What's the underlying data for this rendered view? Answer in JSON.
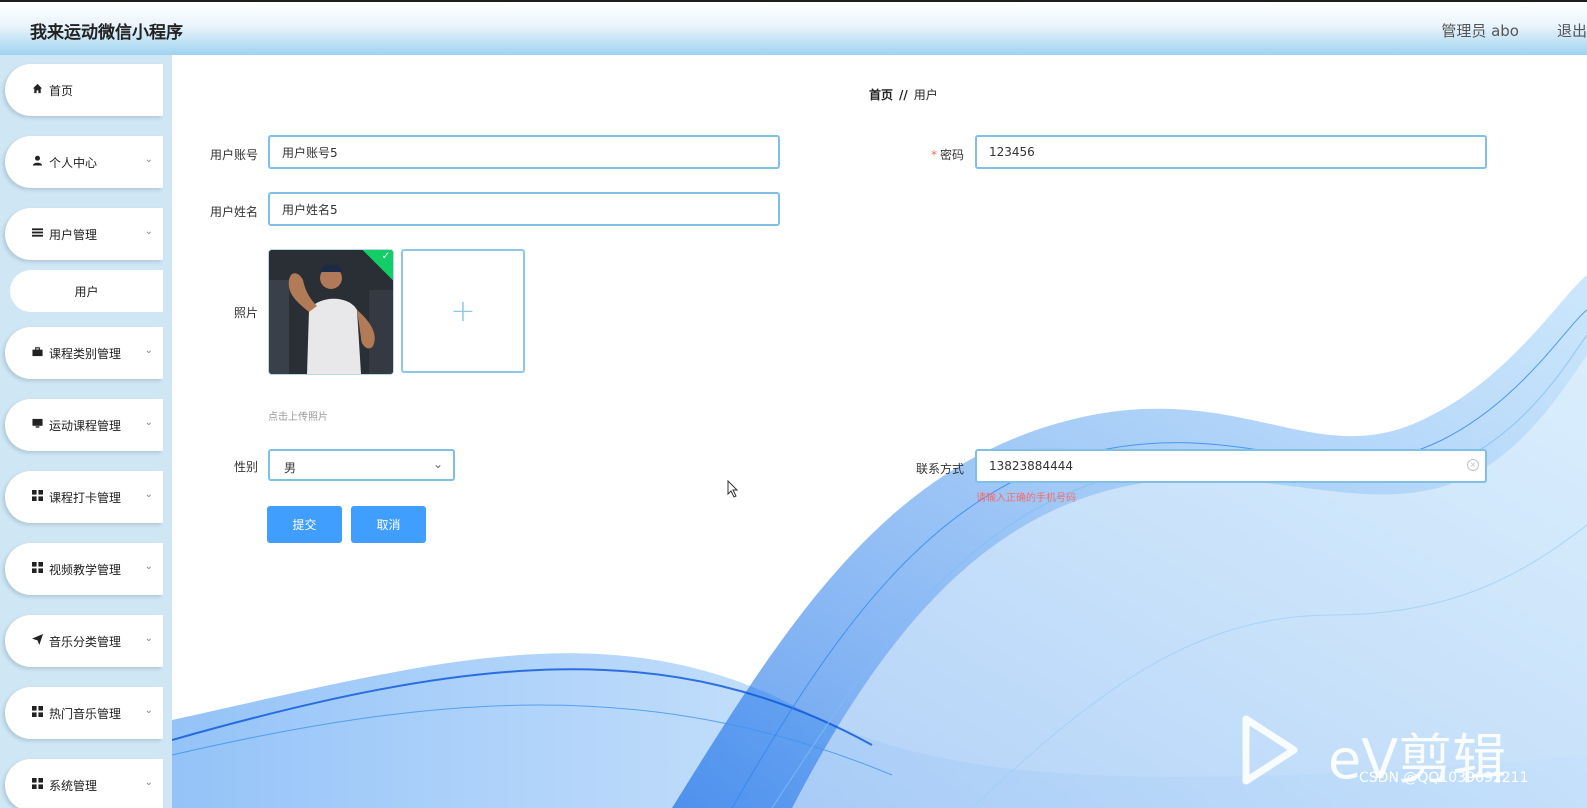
{
  "header": {
    "title": "我来运动微信小程序",
    "user": "管理员 abo",
    "logout": "退出登录"
  },
  "sidebar": {
    "items": [
      {
        "label": "首页",
        "icon": "home-icon"
      },
      {
        "label": "个人中心",
        "icon": "user-icon"
      },
      {
        "label": "用户管理",
        "icon": "list-icon"
      },
      {
        "label": "课程类别管理",
        "icon": "briefcase-icon"
      },
      {
        "label": "运动课程管理",
        "icon": "monitor-icon"
      },
      {
        "label": "课程打卡管理",
        "icon": "grid-icon"
      },
      {
        "label": "视频教学管理",
        "icon": "grid-icon"
      },
      {
        "label": "音乐分类管理",
        "icon": "send-icon"
      },
      {
        "label": "热门音乐管理",
        "icon": "grid-icon"
      },
      {
        "label": "系统管理",
        "icon": "grid-icon"
      }
    ],
    "sub_item": "用户"
  },
  "breadcrumb": {
    "home": "首页",
    "separator": "//",
    "current": "用户"
  },
  "form": {
    "account_label": "用户账号",
    "account_value": "用户账号5",
    "password_label": "密码",
    "password_value": "123456",
    "name_label": "用户姓名",
    "name_value": "用户姓名5",
    "photo_label": "照片",
    "photo_hint": "点击上传照片",
    "gender_label": "性别",
    "gender_value": "男",
    "contact_label": "联系方式",
    "contact_value": "13823884444",
    "contact_error": "请输入正确的手机号码",
    "submit": "提交",
    "cancel": "取消"
  },
  "watermarks": {
    "ev_logo": "eV剪辑",
    "csdn": "CSDN @QQ1039692211"
  },
  "colors": {
    "primary": "#409eff",
    "input_border": "#7fc0e4",
    "sidebar_bg": "#cfe6f4",
    "error": "#f56c6c",
    "success_badge": "#13ce66"
  }
}
